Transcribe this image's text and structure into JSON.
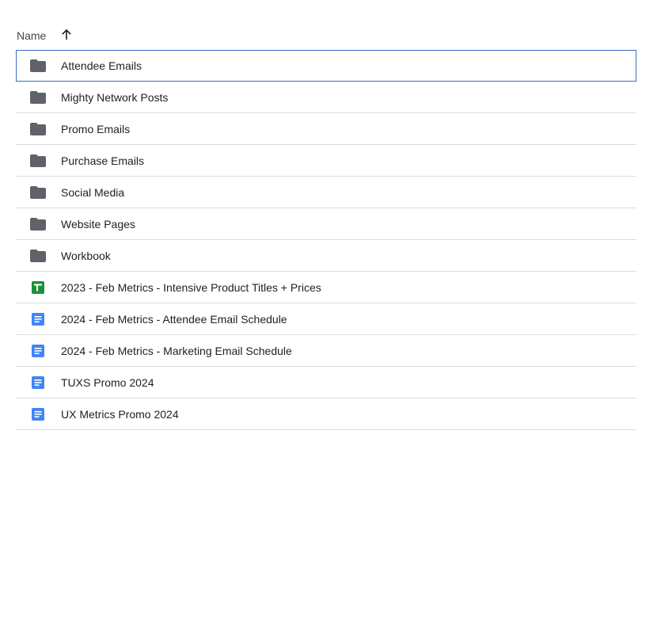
{
  "header": {
    "name_label": "Name",
    "sort_direction": "ascending"
  },
  "colors": {
    "folder": "#5f6368",
    "sheets": "#1e8e3e",
    "docs": "#4285f4",
    "selected_border": "#3c6ec4",
    "divider": "#dadce0"
  },
  "items": [
    {
      "name": "Attendee Emails",
      "type": "folder",
      "icon": "folder-icon",
      "selected": true
    },
    {
      "name": "Mighty Network Posts",
      "type": "folder",
      "icon": "folder-icon"
    },
    {
      "name": "Promo Emails",
      "type": "folder",
      "icon": "folder-icon"
    },
    {
      "name": "Purchase Emails",
      "type": "folder",
      "icon": "folder-icon"
    },
    {
      "name": "Social Media",
      "type": "folder",
      "icon": "folder-icon"
    },
    {
      "name": "Website Pages",
      "type": "folder",
      "icon": "folder-icon"
    },
    {
      "name": "Workbook",
      "type": "folder",
      "icon": "folder-icon"
    },
    {
      "name": "2023 - Feb Metrics - Intensive Product Titles + Prices",
      "type": "sheet",
      "icon": "google-sheets-icon"
    },
    {
      "name": "2024 - Feb Metrics - Attendee Email Schedule",
      "type": "doc",
      "icon": "google-docs-icon"
    },
    {
      "name": "2024 - Feb Metrics - Marketing Email Schedule",
      "type": "doc",
      "icon": "google-docs-icon"
    },
    {
      "name": "TUXS Promo 2024",
      "type": "doc",
      "icon": "google-docs-icon"
    },
    {
      "name": "UX Metrics Promo 2024",
      "type": "doc",
      "icon": "google-docs-icon"
    }
  ]
}
